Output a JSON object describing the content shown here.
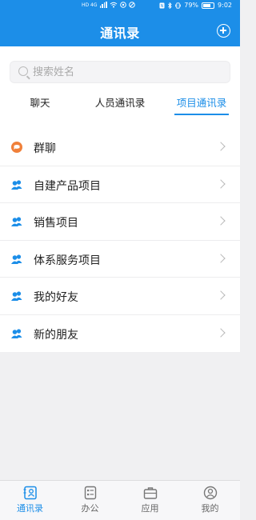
{
  "status_bar": {
    "network": "HD 4G",
    "battery": "79%",
    "time": "9:02"
  },
  "header": {
    "title": "通讯录",
    "add_icon": "plus-circle-icon"
  },
  "search": {
    "placeholder": "搜索姓名",
    "value": ""
  },
  "tabs": [
    {
      "label": "聊天",
      "active": false
    },
    {
      "label": "人员通讯录",
      "active": false
    },
    {
      "label": "项目通讯录",
      "active": true
    }
  ],
  "list": [
    {
      "label": "群聊",
      "icon": "chat-bubble-icon",
      "color": "#f0803a"
    },
    {
      "label": "自建产品项目",
      "icon": "group-icon",
      "color": "#1c8ee8"
    },
    {
      "label": "销售项目",
      "icon": "group-icon",
      "color": "#1c8ee8"
    },
    {
      "label": "体系服务项目",
      "icon": "group-icon",
      "color": "#1c8ee8"
    },
    {
      "label": "我的好友",
      "icon": "group-icon",
      "color": "#1c8ee8"
    },
    {
      "label": "新的朋友",
      "icon": "group-icon",
      "color": "#1c8ee8"
    }
  ],
  "bottom_nav": [
    {
      "label": "通讯录",
      "icon": "contacts-icon",
      "active": true
    },
    {
      "label": "办公",
      "icon": "office-icon",
      "active": false
    },
    {
      "label": "应用",
      "icon": "briefcase-icon",
      "active": false
    },
    {
      "label": "我的",
      "icon": "profile-icon",
      "active": false
    }
  ],
  "colors": {
    "accent": "#1c8ee8",
    "group_chat": "#f0803a",
    "background": "#f0f0f2"
  }
}
